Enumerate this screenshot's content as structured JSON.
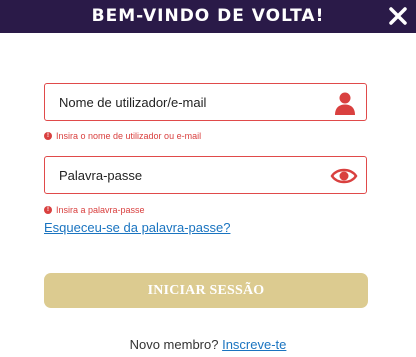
{
  "header": {
    "title": "BEM-VINDO DE VOLTA!",
    "close_icon": "close-icon"
  },
  "username": {
    "placeholder": "Nome de utilizador/e-mail",
    "value": "",
    "icon": "user-icon",
    "error": "Insira o nome de utilizador ou e-mail"
  },
  "password": {
    "placeholder": "Palavra-passe",
    "value": "",
    "icon": "eye-icon",
    "error": "Insira a palavra-passe"
  },
  "forgot_link": "Esqueceu-se da palavra-passe?",
  "login_button": "INICIAR SESSÃO",
  "footer": {
    "text": "Novo membro?",
    "signup_link": "Inscreve-te"
  },
  "colors": {
    "header_bg": "#2a1a48",
    "error": "#d9403f",
    "button_bg": "#dccb90",
    "link": "#1a74c0"
  }
}
